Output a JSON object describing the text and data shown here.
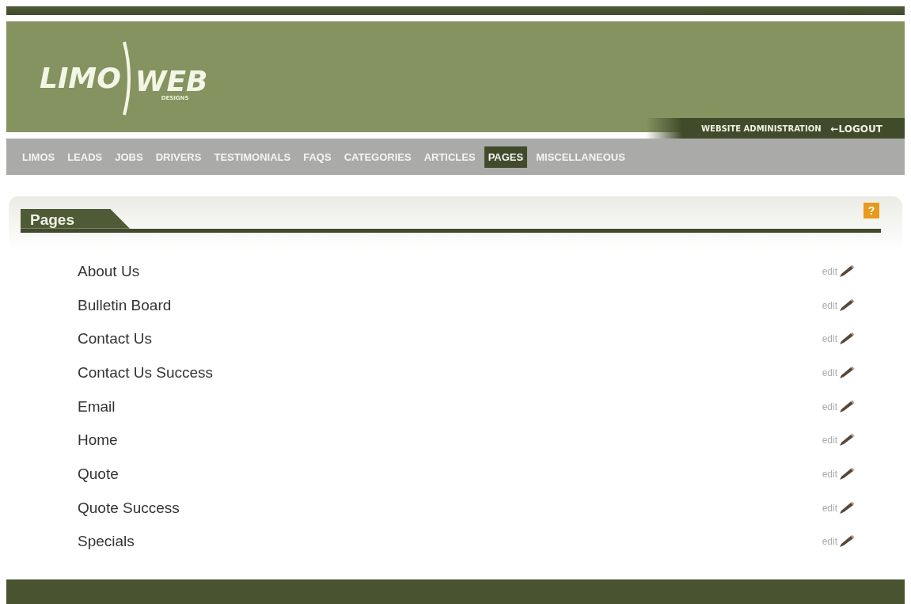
{
  "logo": {
    "word_1": "LIMO",
    "word_2": "WEB",
    "tagline": "DESIGNS"
  },
  "admin_bar": {
    "title": "WEBSITE ADMINISTRATION",
    "logout": "←LOGOUT"
  },
  "nav": [
    {
      "label": "LIMOS",
      "selected": false
    },
    {
      "label": "LEADS",
      "selected": false
    },
    {
      "label": "JOBS",
      "selected": false
    },
    {
      "label": "DRIVERS",
      "selected": false
    },
    {
      "label": "TESTIMONIALS",
      "selected": false
    },
    {
      "label": "FAQS",
      "selected": false
    },
    {
      "label": "CATEGORIES",
      "selected": false
    },
    {
      "label": "ARTICLES",
      "selected": false
    },
    {
      "label": "PAGES",
      "selected": true
    },
    {
      "label": "MISCELLANEOUS",
      "selected": false
    }
  ],
  "panel": {
    "title": "Pages",
    "help": "?"
  },
  "pages": [
    {
      "name": "About Us",
      "action": "edit"
    },
    {
      "name": "Bulletin Board",
      "action": "edit"
    },
    {
      "name": "Contact Us",
      "action": "edit"
    },
    {
      "name": "Contact Us Success",
      "action": "edit"
    },
    {
      "name": "Email",
      "action": "edit"
    },
    {
      "name": "Home",
      "action": "edit"
    },
    {
      "name": "Quote",
      "action": "edit"
    },
    {
      "name": "Quote Success",
      "action": "edit"
    },
    {
      "name": "Specials",
      "action": "edit"
    }
  ]
}
